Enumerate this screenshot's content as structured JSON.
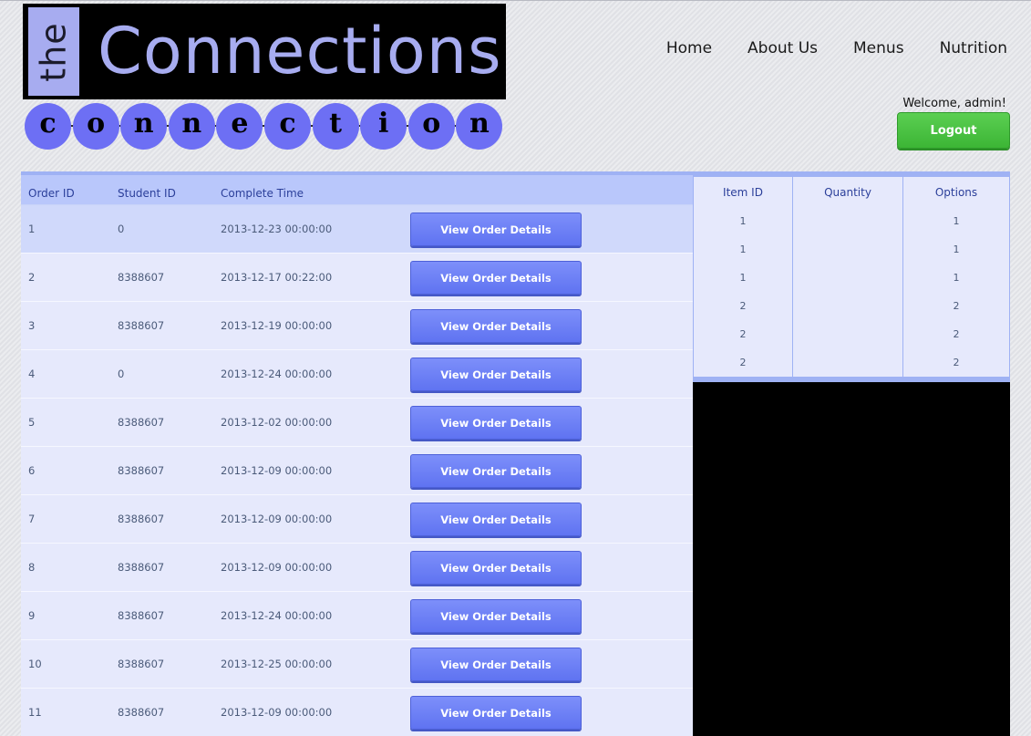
{
  "logo": {
    "the": "the",
    "word": "Connections",
    "beads": [
      "c",
      "o",
      "n",
      "n",
      "e",
      "c",
      "t",
      "i",
      "o",
      "n"
    ]
  },
  "nav": [
    "Home",
    "About Us",
    "Menus",
    "Nutrition"
  ],
  "welcome": "Welcome, admin!",
  "logout_label": "Logout",
  "orders": {
    "headers": [
      "Order ID",
      "Student ID",
      "Complete Time"
    ],
    "button_label": "View Order Details",
    "rows": [
      {
        "id": "1",
        "student": "0",
        "time": "2013-12-23 00:00:00"
      },
      {
        "id": "2",
        "student": "8388607",
        "time": "2013-12-17 00:22:00"
      },
      {
        "id": "3",
        "student": "8388607",
        "time": "2013-12-19 00:00:00"
      },
      {
        "id": "4",
        "student": "0",
        "time": "2013-12-24 00:00:00"
      },
      {
        "id": "5",
        "student": "8388607",
        "time": "2013-12-02 00:00:00"
      },
      {
        "id": "6",
        "student": "8388607",
        "time": "2013-12-09 00:00:00"
      },
      {
        "id": "7",
        "student": "8388607",
        "time": "2013-12-09 00:00:00"
      },
      {
        "id": "8",
        "student": "8388607",
        "time": "2013-12-09 00:00:00"
      },
      {
        "id": "9",
        "student": "8388607",
        "time": "2013-12-24 00:00:00"
      },
      {
        "id": "10",
        "student": "8388607",
        "time": "2013-12-25 00:00:00"
      },
      {
        "id": "11",
        "student": "8388607",
        "time": "2013-12-09 00:00:00"
      }
    ]
  },
  "details": {
    "headers": [
      "Item ID",
      "Quantity",
      "Options"
    ],
    "item_ids": [
      "1",
      "1",
      "1",
      "2",
      "2",
      "2"
    ],
    "quantities": [
      "",
      "",
      "",
      "",
      "",
      ""
    ],
    "options": [
      "1",
      "1",
      "1",
      "2",
      "2",
      "2"
    ]
  }
}
